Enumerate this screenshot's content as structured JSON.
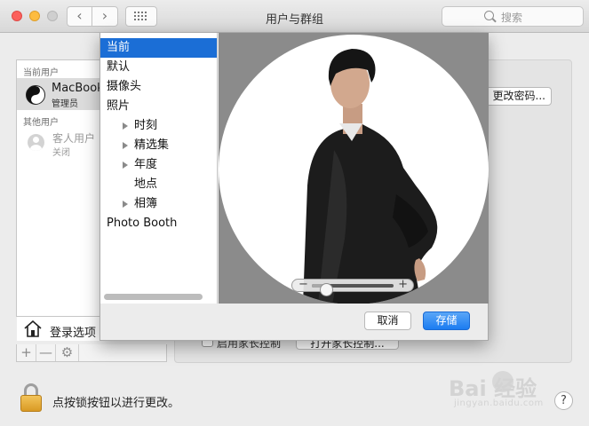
{
  "window": {
    "title": "用户与群组",
    "search_placeholder": "搜索",
    "back_glyph": "‹",
    "forward_glyph": "›"
  },
  "users": {
    "current_label": "当前用户",
    "current_user": {
      "name": "MacBook",
      "role": "管理员",
      "avatar": "yin-yang-icon"
    },
    "other_label": "其他用户",
    "guest": {
      "name": "客人用户",
      "status": "关闭"
    },
    "login_options_label": "登录选项",
    "add_glyph": "+",
    "remove_glyph": "—",
    "settings_glyph": "⚙"
  },
  "account": {
    "change_password_label": "更改密码...",
    "parental_checkbox_label": "启用家长控制",
    "parental_button_label": "打开家长控制..."
  },
  "lock": {
    "text": "点按锁按钮以进行更改。"
  },
  "help_glyph": "?",
  "picker": {
    "sources": [
      {
        "label": "当前",
        "selected": true
      },
      {
        "label": "默认"
      },
      {
        "label": "摄像头"
      },
      {
        "label": "照片"
      },
      {
        "label": "时刻",
        "child": true,
        "expandable": true
      },
      {
        "label": "精选集",
        "child": true,
        "expandable": true
      },
      {
        "label": "年度",
        "child": true,
        "expandable": true
      },
      {
        "label": "地点",
        "child": true
      },
      {
        "label": "相簿",
        "child": true,
        "expandable": true
      },
      {
        "label": "Photo Booth"
      }
    ],
    "zoom_minus": "−",
    "zoom_plus": "+",
    "zoom_level": 0.12,
    "cancel_label": "取消",
    "save_label": "存储"
  },
  "watermark": {
    "logo": "Bai  经验",
    "sub": "jingyan.baidu.com"
  },
  "colors": {
    "accent": "#1b6ed6",
    "save_button": "#1b7cf1"
  }
}
